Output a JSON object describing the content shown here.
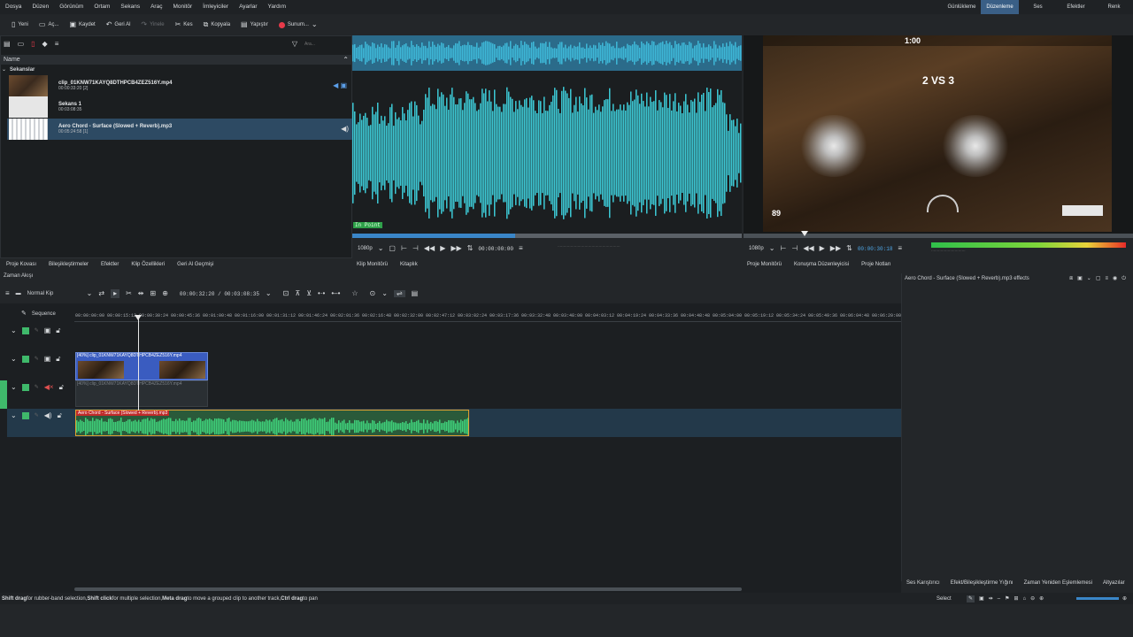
{
  "menu": [
    "Dosya",
    "Düzen",
    "Görünüm",
    "Ortam",
    "Sekans",
    "Araç",
    "Monitör",
    "İmleyiciler",
    "Ayarlar",
    "Yardım"
  ],
  "layouts": {
    "items": [
      "Günlükleme",
      "Düzenleme",
      "Ses",
      "Efektler",
      "Renk"
    ],
    "active": "Düzenleme"
  },
  "toolbar": {
    "new": "Yeni",
    "open": "Aç...",
    "save": "Kaydet",
    "undo": "Geri Al",
    "redo": "Yinele",
    "cut": "Kes",
    "copy": "Kopyala",
    "paste": "Yapıştır",
    "render": "Sunum..."
  },
  "project_bin": {
    "search_placeholder": "Ara...",
    "header": "Name",
    "folder": "Sekanslar",
    "items": [
      {
        "name": "clip_01KNW71KAYQ8DTHPCB4ZEZ516Y.mp4",
        "meta": "00:00:33:20 [2]"
      },
      {
        "name": "Sekans 1",
        "meta": "00:03:08:35"
      },
      {
        "name": "Aero Chord - Surface (Slowed + Reverb).mp3",
        "meta": "00:05:24:58 [1]"
      }
    ],
    "tabs": [
      "Proje Kovası",
      "Bileşikleştirmeler",
      "Efektler",
      "Klip Özellikleri",
      "Geri Al Geçmişi"
    ]
  },
  "clip_monitor": {
    "in_point": "In Point",
    "resolution": "1080p",
    "timecode": "00:00:00:00",
    "tabs": [
      "Klip Monitörü",
      "Kitaplık"
    ]
  },
  "project_monitor": {
    "resolution": "1080p",
    "timecode": "00:00:30:18",
    "hud_score": "2 VS 3",
    "hud_timer": "1:00",
    "tabs": [
      "Proje Monitörü",
      "Konuşma Düzenleyicisi",
      "Proje Notları"
    ]
  },
  "timeline": {
    "title": "Zaman Akışı",
    "mode": "Normal Kip",
    "timecode": "00:00:32:20 / 00:03:08:35",
    "sequence": "Sequence",
    "ruler": [
      "00:00:00:00",
      "00:00:15:12",
      "00:00:30:24",
      "00:00:45:36",
      "00:01:00:48",
      "00:01:16:00",
      "00:01:31:12",
      "00:01:46:24",
      "00:02:01:36",
      "00:02:16:48",
      "00:02:32:00",
      "00:02:47:12",
      "00:03:02:24",
      "00:03:17:36",
      "00:03:32:48",
      "00:03:48:00",
      "00:04:03:12",
      "00:04:19:24",
      "00:04:33:36",
      "00:04:48:48",
      "00:05:04:00",
      "00:05:19:12",
      "00:05:34:24",
      "00:05:49:36",
      "00:06:04:48",
      "00:06:20:00"
    ],
    "video_clip": "[40%] clip_01KNW71KAYQ8DTHPCB4ZEZ516Y.mp4",
    "video_audio_clip": "[40%] clip_01KNW71KAYQ8DTHPCB4ZEZ516Y.mp4",
    "audio_clip": "Aero Chord - Surface (Slowed + Reverb).mp3"
  },
  "effects_panel": {
    "title": "Aero Chord - Surface (Slowed + Reverb).mp3 effects",
    "tabs": [
      "Ses Karıştırıcı",
      "Efekt/Bileşikleştirme Yığını",
      "Zaman Yeniden Eşlemlemesi",
      "Altyazılar"
    ]
  },
  "status": {
    "k1": "Shift drag",
    "t1": " for rubber-band selection, ",
    "k2": "Shift click",
    "t2": " for multiple selection, ",
    "k3": "Meta drag",
    "t3": " to move a grouped clip to another track, ",
    "k4": "Ctrl drag",
    "t4": " to pan",
    "tool": "Select"
  },
  "colors": {
    "accent": "#3a5f86",
    "audio_wave": "#3cc8d4",
    "audio_clip": "#3fd07a",
    "video_clip": "#3a5cc0",
    "selected_border": "#e0a030"
  }
}
